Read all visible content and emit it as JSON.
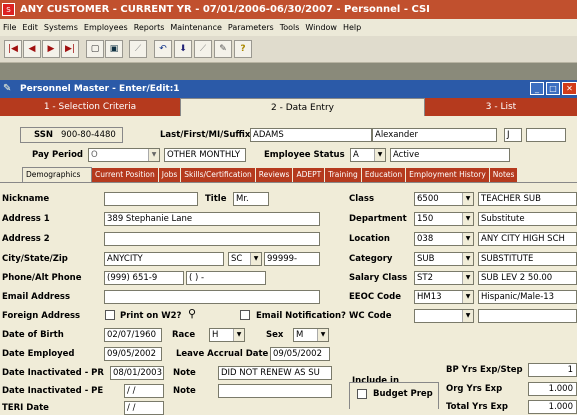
{
  "app": {
    "title": "ANY CUSTOMER - CURRENT YR - 07/01/2006-06/30/2007 - Personnel - CSI",
    "icon_text": "S"
  },
  "menu": [
    "File",
    "Edit",
    "Systems",
    "Employees",
    "Reports",
    "Maintenance",
    "Parameters",
    "Tools",
    "Window",
    "Help"
  ],
  "toolbar_icons": [
    "first-icon",
    "prev-icon",
    "next-icon",
    "last-icon",
    "new-icon",
    "save-icon",
    "chart-icon",
    "undo-icon",
    "bookmark-icon",
    "compare-icon",
    "tools-icon",
    "help-icon"
  ],
  "child": {
    "title": "Personnel Master - Enter/Edit:1"
  },
  "main_tabs": [
    {
      "label": "1 - Selection Criteria"
    },
    {
      "label": "2 - Data Entry"
    },
    {
      "label": "3 - List"
    }
  ],
  "header": {
    "ssn_label": "SSN",
    "ssn_value": "900-80-4480",
    "name_label": "Last/First/MI/Suffix",
    "last": "ADAMS",
    "first": "Alexander",
    "mi": "J",
    "suffix": "",
    "pay_period_label": "Pay Period",
    "pay_period_code": "O",
    "pay_period_desc": "OTHER MONTHLY",
    "emp_status_label": "Employee Status",
    "emp_status_code": "A",
    "emp_status_desc": "Active"
  },
  "sub_tabs": [
    "Demographics",
    "Current Position",
    "Jobs",
    "Skills/Certification",
    "Reviews",
    "ADEPT",
    "Training",
    "Education",
    "Employment History",
    "Notes"
  ],
  "left": {
    "nickname_label": "Nickname",
    "nickname": "",
    "title_label": "Title",
    "title": "Mr.",
    "addr1_label": "Address 1",
    "addr1": "389 Stephanie Lane",
    "addr2_label": "Address 2",
    "addr2": "",
    "city_label": "City/State/Zip",
    "city": "ANYCITY",
    "state": "SC",
    "zip": "99999-",
    "phone_label": "Phone/Alt Phone",
    "phone": "(999) 651-9",
    "alt_phone": "(  )  -",
    "email_label": "Email Address",
    "email": "",
    "foreign_label": "Foreign Address",
    "print_w2_label": "Print on W2?",
    "email_notif_label": "Email Notification?",
    "dob_label": "Date of Birth",
    "dob": "02/07/1960",
    "race_label": "Race",
    "race": "H",
    "sex_label": "Sex",
    "sex": "M",
    "employed_label": "Date Employed",
    "employed": "09/05/2002",
    "accrual_label": "Leave Accrual Date",
    "accrual": "09/05/2002",
    "inact_pr_label": "Date Inactivated - PR",
    "inact_pr": "08/01/2003",
    "note_label": "Note",
    "note1": "DID NOT RENEW AS SU",
    "inact_pe_label": "Date Inactivated - PE",
    "inact_pe": "/ /",
    "note2": "",
    "teri_label": "TERI Date",
    "teri": "/ /"
  },
  "right": {
    "class_label": "Class",
    "class_code": "6500",
    "class_desc": "TEACHER SUB",
    "dept_label": "Department",
    "dept_code": "150",
    "dept_desc": "Substitute",
    "loc_label": "Location",
    "loc_code": "038",
    "loc_desc": "ANY CITY HIGH SCH",
    "cat_label": "Category",
    "cat_code": "SUB",
    "cat_desc": "SUBSTITUTE",
    "sal_label": "Salary Class",
    "sal_code": "ST2",
    "sal_desc": "SUB LEV 2 50.00",
    "eeoc_label": "EEOC Code",
    "eeoc_code": "HM13",
    "eeoc_desc": "Hispanic/Male-13",
    "wc_label": "WC Code",
    "wc_code": "",
    "wc_desc": "",
    "include_label": "Include in",
    "budget_label": "Budget Prep",
    "bp_label": "BP Yrs Exp/Step",
    "bp_value": "1",
    "org_label": "Org Yrs Exp",
    "org_value": "1.000",
    "total_label": "Total Yrs Exp",
    "total_value": "1.000"
  }
}
